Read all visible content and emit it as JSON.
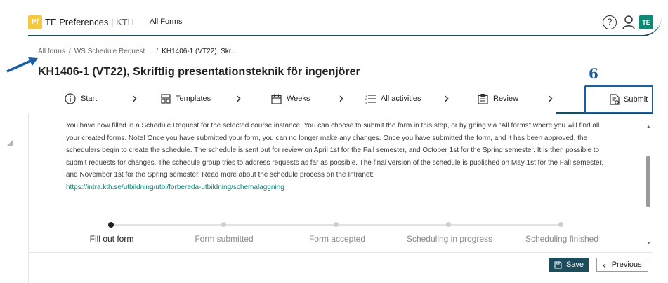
{
  "header": {
    "logo_text": "Pf",
    "app_name": "TE Preferences",
    "app_org": "KTH",
    "nav_all_forms": "All Forms",
    "help_glyph": "?",
    "avatar_initials": "TE"
  },
  "breadcrumb": {
    "items": [
      "All forms",
      "WS Schedule Request ...",
      "KH1406-1 (VT22), Skr..."
    ]
  },
  "page_title": "KH1406-1 (VT22), Skriftlig presentationsteknik för ingenjörer",
  "annotation_number": "6",
  "steps": [
    {
      "label": "Start",
      "icon": "info-icon"
    },
    {
      "label": "Templates",
      "icon": "templates-icon"
    },
    {
      "label": "Weeks",
      "icon": "calendar-icon"
    },
    {
      "label": "All activities",
      "icon": "list-icon"
    },
    {
      "label": "Review",
      "icon": "review-icon"
    },
    {
      "label": "Submit",
      "icon": "submit-icon"
    }
  ],
  "description": "You have now filled in a Schedule Request for the selected course instance. You can choose to submit the form in this step, or by going via \"All forms\" where you will find all your created forms. Note! Once you have submitted your form, you can no longer make any changes. Once you have submitted the form, and it has been approved, the schedulers begin to create the schedule. The schedule is sent out for review on April 1st for the Fall semester, and October 1st for the Spring semester. It is then possible to submit requests for changes. The schedule group tries to address requests as far as possible. The final version of the schedule is published on May 1st for the Fall semester, and November 1st for the Spring semester. Read more about the schedule process on the Intranet:",
  "description_link": "https://intra.kth.se/utbildning/utbi/forbereda-utbildning/schemalaggning",
  "progress": {
    "stages": [
      "Fill out form",
      "Form submitted",
      "Form accepted",
      "Scheduling in progress",
      "Scheduling finished"
    ],
    "current_index": 0
  },
  "footer": {
    "save_label": "Save",
    "previous_label": "Previous"
  },
  "colors": {
    "accent": "#1d4d5c",
    "highlight_box": "#1b5ea3",
    "link": "#0d8a76",
    "avatar_bg": "#0d8a76",
    "logo_bg": "#f5c842"
  }
}
